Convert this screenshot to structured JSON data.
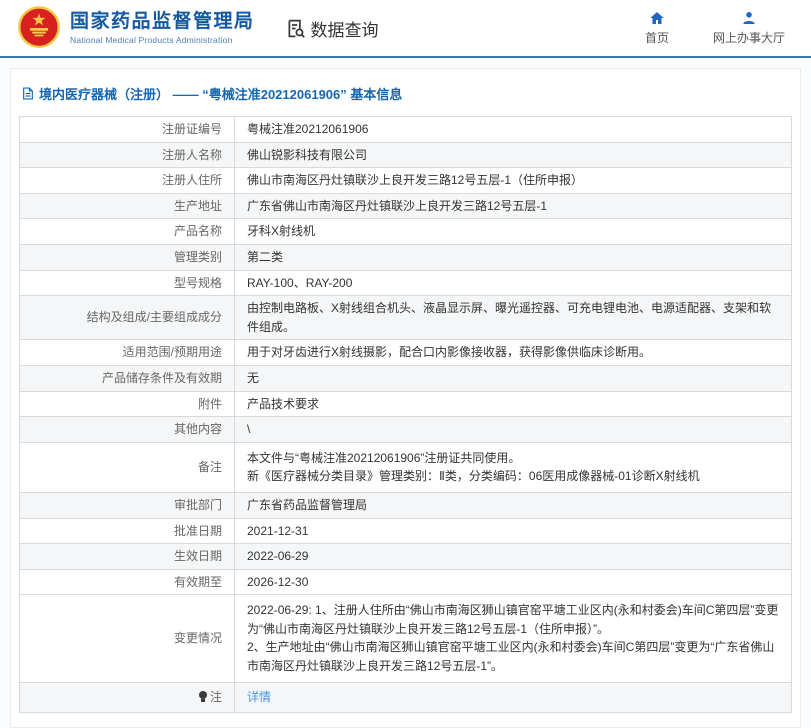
{
  "header": {
    "agency_name_zh": "国家药品监督管理局",
    "agency_name_en": "National Medical Products Administration",
    "data_query_label": "数据查询",
    "nav_items": [
      {
        "label": "首页",
        "icon": "home-icon"
      },
      {
        "label": "网上办事大厅",
        "icon": "user-icon"
      }
    ]
  },
  "page": {
    "title": "境内医疗器械（注册） —— “粤械注准20212061906” 基本信息"
  },
  "table": {
    "rows": [
      {
        "label": "注册证编号",
        "value": "粤械注准20212061906"
      },
      {
        "label": "注册人名称",
        "value": "佛山锐影科技有限公司"
      },
      {
        "label": "注册人住所",
        "value": "佛山市南海区丹灶镇联沙上良开发三路12号五层-1（住所申报）"
      },
      {
        "label": "生产地址",
        "value": "广东省佛山市南海区丹灶镇联沙上良开发三路12号五层-1"
      },
      {
        "label": "产品名称",
        "value": "牙科X射线机"
      },
      {
        "label": "管理类别",
        "value": "第二类"
      },
      {
        "label": "型号规格",
        "value": "RAY-100、RAY-200"
      },
      {
        "label": "结构及组成/主要组成成分",
        "value": "由控制电路板、X射线组合机头、液晶显示屏、曝光遥控器、可充电锂电池、电源适配器、支架和软件组成。"
      },
      {
        "label": "适用范围/预期用途",
        "value": "用于对牙齿进行X射线摄影，配合口内影像接收器，获得影像供临床诊断用。"
      },
      {
        "label": "产品储存条件及有效期",
        "value": "无"
      },
      {
        "label": "附件",
        "value": "产品技术要求"
      },
      {
        "label": "其他内容",
        "value": "\\"
      },
      {
        "label": "备注",
        "value": "本文件与“粤械注准20212061906”注册证共同使用。\n新《医疗器械分类目录》管理类别：Ⅱ类，分类编码：06医用成像器械-01诊断X射线机",
        "tall": true
      },
      {
        "label": "审批部门",
        "value": "广东省药品监督管理局"
      },
      {
        "label": "批准日期",
        "value": "2021-12-31"
      },
      {
        "label": "生效日期",
        "value": "2022-06-29"
      },
      {
        "label": "有效期至",
        "value": "2026-12-30"
      },
      {
        "label": "变更情况",
        "value": "2022-06-29: 1、注册人住所由“佛山市南海区狮山镇官窑平塘工业区内(永和村委会)车间C第四层”变更为“佛山市南海区丹灶镇联沙上良开发三路12号五层-1（住所申报）”。\n2、生产地址由“佛山市南海区狮山镇官窑平塘工业区内(永和村委会)车间C第四层”变更为“广东省佛山市南海区丹灶镇联沙上良开发三路12号五层-1”。",
        "tall": true
      },
      {
        "label": "注",
        "value": "详情",
        "link": true,
        "label_icon": "note-bulb-icon",
        "note_row": true
      }
    ]
  },
  "colors": {
    "header_border_blue": "#3779b5",
    "agency_blue": "#15599f",
    "nav_icon_blue": "#2166c0",
    "title_blue": "#1667b1",
    "link_blue": "#4596e6",
    "row_stripe": "#f5f6f7",
    "table_border": "#d9d9d9",
    "emblem_red": "#d6211f",
    "emblem_gold": "#f7c948"
  }
}
